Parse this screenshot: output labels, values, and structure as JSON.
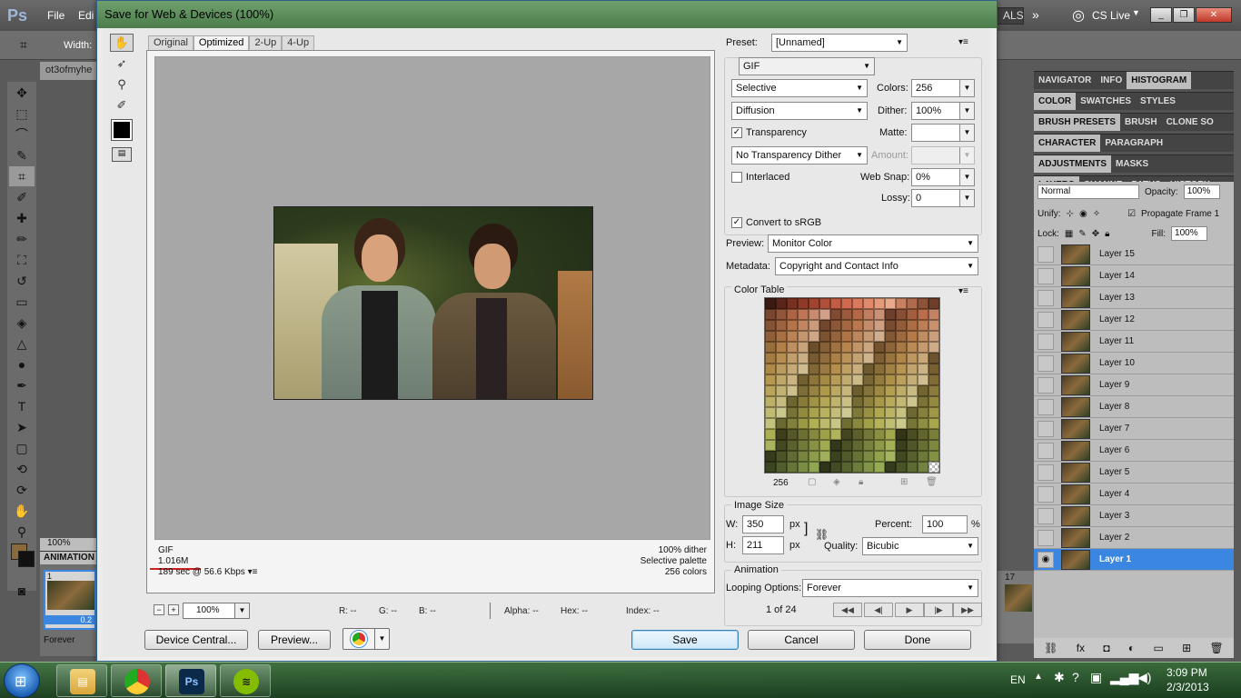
{
  "ps": {
    "logo": "Ps",
    "menus": [
      "File",
      "Edi"
    ],
    "options_width_label": "Width:",
    "workspace_label": "ALS",
    "cs_live": "CS Live",
    "doc_tab": "ot3ofmyhe",
    "zoom": "100%",
    "animation_tab": "ANIMATION",
    "frame_num": "1",
    "frame_time": "0.2",
    "loop": "Forever",
    "frame17": "17"
  },
  "panels": {
    "row1": [
      "NAVIGATOR",
      "INFO",
      "HISTOGRAM"
    ],
    "row2": [
      "COLOR",
      "SWATCHES",
      "STYLES"
    ],
    "row3": [
      "BRUSH PRESETS",
      "BRUSH",
      "CLONE SO"
    ],
    "row4": [
      "CHARACTER",
      "PARAGRAPH"
    ],
    "row5": [
      "ADJUSTMENTS",
      "MASKS"
    ],
    "row6": [
      "LAYERS",
      "CHANNE",
      "PATHS",
      "HISTORY"
    ],
    "blend_mode": "Normal",
    "opacity_label": "Opacity:",
    "opacity": "100%",
    "unify_label": "Unify:",
    "propagate": "Propagate Frame 1",
    "lock_label": "Lock:",
    "fill_label": "Fill:",
    "fill": "100%",
    "layers": [
      "Layer 15",
      "Layer 14",
      "Layer 13",
      "Layer 12",
      "Layer 11",
      "Layer 10",
      "Layer 9",
      "Layer 8",
      "Layer 7",
      "Layer 6",
      "Layer 5",
      "Layer 4",
      "Layer 3",
      "Layer 2",
      "Layer 1"
    ],
    "selected_layer": "Layer 1"
  },
  "dialog": {
    "title": "Save for Web & Devices (100%)",
    "tabs": [
      "Original",
      "Optimized",
      "2-Up",
      "4-Up"
    ],
    "active_tab": "Optimized",
    "info_format": "GIF",
    "info_size": "1.016M",
    "info_time": "189 sec @ 56.6 Kbps",
    "info_dither": "100% dither",
    "info_palette": "Selective palette",
    "info_colors": "256 colors",
    "zoom": "100%",
    "r": "R: --",
    "g": "G: --",
    "b": "B: --",
    "alpha": "Alpha: --",
    "hex": "Hex: --",
    "index": "Index: --",
    "buttons": {
      "device_central": "Device Central...",
      "preview": "Preview...",
      "save": "Save",
      "cancel": "Cancel",
      "done": "Done"
    }
  },
  "settings": {
    "preset_label": "Preset:",
    "preset": "[Unnamed]",
    "format": "GIF",
    "reduction": "Selective",
    "colors_label": "Colors:",
    "colors": "256",
    "dither_algo": "Diffusion",
    "dither_label": "Dither:",
    "dither": "100%",
    "transparency": "Transparency",
    "matte_label": "Matte:",
    "trans_dither": "No Transparency Dither",
    "amount_label": "Amount:",
    "interlaced": "Interlaced",
    "websnap_label": "Web Snap:",
    "websnap": "0%",
    "lossy_label": "Lossy:",
    "lossy": "0",
    "convert_srgb": "Convert to sRGB",
    "preview_label": "Preview:",
    "preview": "Monitor Color",
    "metadata_label": "Metadata:",
    "metadata": "Copyright and Contact Info",
    "color_table_title": "Color Table",
    "color_count": "256",
    "image_size_title": "Image Size",
    "w_label": "W:",
    "w": "350",
    "h_label": "H:",
    "h": "211",
    "px": "px",
    "percent_label": "Percent:",
    "percent": "100",
    "pct": "%",
    "quality_label": "Quality:",
    "quality": "Bicubic",
    "animation_title": "Animation",
    "looping_label": "Looping Options:",
    "looping": "Forever",
    "frame_counter": "1 of 24"
  },
  "colors": {
    "palette": [
      "#3a1a12",
      "#5a2418",
      "#7a3020",
      "#8e3a26",
      "#a04430",
      "#b0503a",
      "#c25c44",
      "#cf6a4e",
      "#da7a5c",
      "#e08a6a",
      "#e59a7a",
      "#e8aa8a",
      "#c98060",
      "#b06a4c",
      "#8e5238",
      "#6e3e2a"
    ]
  },
  "taskbar": {
    "lang": "EN",
    "time": "3:09 PM",
    "date": "2/3/2013",
    "ps_label": "Ps"
  }
}
